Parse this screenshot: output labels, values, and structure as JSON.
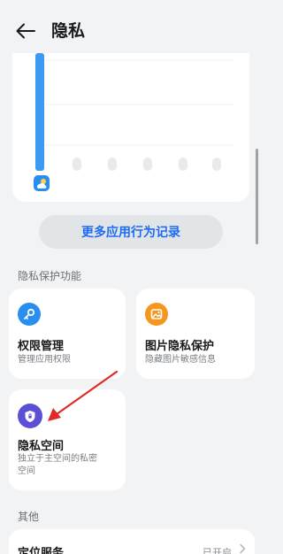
{
  "header": {
    "title": "隐私",
    "back_icon": "back-arrow-icon"
  },
  "usage_chart": {
    "app_icon": "weather-app-icon",
    "highlight_color": "#3d9af2",
    "bar_count": 6
  },
  "more_button_label": "更多应用行为记录",
  "sections": {
    "privacy_features_label": "隐私保护功能",
    "other_label": "其他"
  },
  "features": [
    {
      "title": "权限管理",
      "subtitle": "管理应用权限",
      "icon": "key-icon",
      "icon_color": "#2a8ef0"
    },
    {
      "title": "图片隐私保护",
      "subtitle": "隐藏图片敏感信息",
      "icon": "image-icon",
      "icon_color": "#f5961f"
    },
    {
      "title": "隐私空间",
      "subtitle": "独立于主空间的私密空间",
      "subtitle_line1": "独立于主空间的私密",
      "subtitle_line2": "空间",
      "icon": "shield-icon",
      "icon_color": "#5a4fd6"
    }
  ],
  "other_rows": [
    {
      "title": "定位服务",
      "value": "已开启",
      "icon": "chevron-right-icon"
    }
  ],
  "annotation": {
    "arrow_color": "#e02a26"
  }
}
